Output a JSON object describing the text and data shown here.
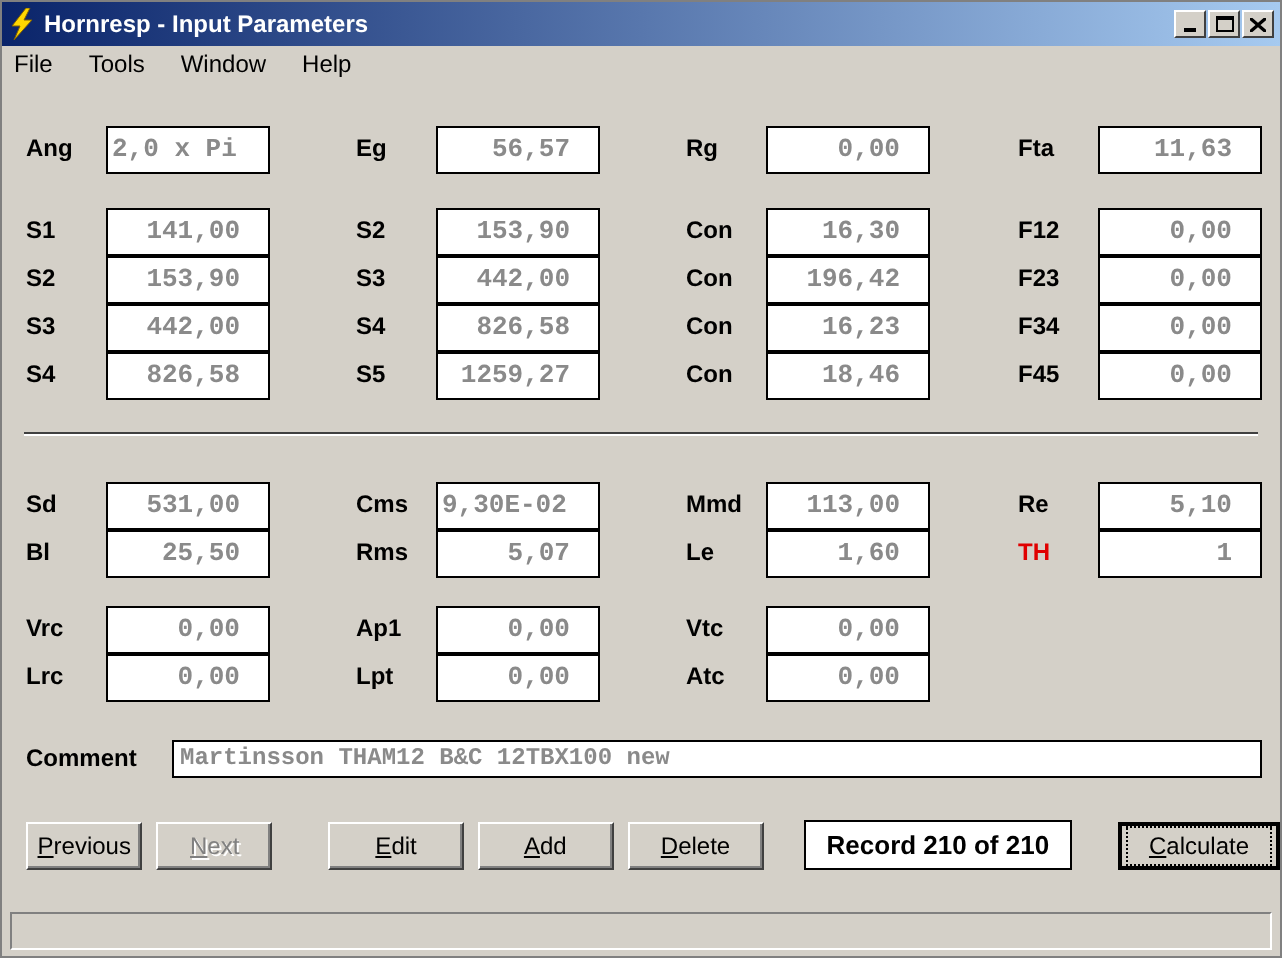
{
  "window": {
    "title": "Hornresp - Input Parameters"
  },
  "menu": [
    "File",
    "Tools",
    "Window",
    "Help"
  ],
  "blocks": [
    {
      "kind": "fields",
      "rows": [
        [
          {
            "label": "Ang",
            "value": "2,0 x Pi",
            "kind": "text"
          },
          {
            "label": "Eg",
            "value": "56,57",
            "kind": "number"
          },
          {
            "label": "Rg",
            "value": "0,00",
            "kind": "number"
          },
          {
            "label": "Fta",
            "value": "11,63",
            "kind": "number"
          }
        ]
      ]
    },
    {
      "kind": "fields",
      "rows": [
        [
          {
            "label": "S1",
            "value": "141,00",
            "kind": "number"
          },
          {
            "label": "S2",
            "value": "153,90",
            "kind": "number"
          },
          {
            "label": "Con",
            "value": "16,30",
            "kind": "number"
          },
          {
            "label": "F12",
            "value": "0,00",
            "kind": "number"
          }
        ],
        [
          {
            "label": "S2",
            "value": "153,90",
            "kind": "number"
          },
          {
            "label": "S3",
            "value": "442,00",
            "kind": "number"
          },
          {
            "label": "Con",
            "value": "196,42",
            "kind": "number"
          },
          {
            "label": "F23",
            "value": "0,00",
            "kind": "number"
          }
        ],
        [
          {
            "label": "S3",
            "value": "442,00",
            "kind": "number"
          },
          {
            "label": "S4",
            "value": "826,58",
            "kind": "number"
          },
          {
            "label": "Con",
            "value": "16,23",
            "kind": "number"
          },
          {
            "label": "F34",
            "value": "0,00",
            "kind": "number"
          }
        ],
        [
          {
            "label": "S4",
            "value": "826,58",
            "kind": "number"
          },
          {
            "label": "S5",
            "value": "1259,27",
            "kind": "number"
          },
          {
            "label": "Con",
            "value": "18,46",
            "kind": "number"
          },
          {
            "label": "F45",
            "value": "0,00",
            "kind": "number"
          }
        ]
      ]
    },
    {
      "kind": "divider"
    },
    {
      "kind": "fields",
      "rows": [
        [
          {
            "label": "Sd",
            "value": "531,00",
            "kind": "number"
          },
          {
            "label": "Cms",
            "value": "9,30E-02",
            "kind": "text"
          },
          {
            "label": "Mmd",
            "value": "113,00",
            "kind": "number"
          },
          {
            "label": "Re",
            "value": "5,10",
            "kind": "number"
          }
        ],
        [
          {
            "label": "Bl",
            "value": "25,50",
            "kind": "number"
          },
          {
            "label": "Rms",
            "value": "5,07",
            "kind": "number"
          },
          {
            "label": "Le",
            "value": "1,60",
            "kind": "number"
          },
          {
            "label": "TH",
            "value": "1",
            "kind": "number",
            "color": "#e00000"
          }
        ]
      ]
    },
    {
      "kind": "fields",
      "rows": [
        [
          {
            "label": "Vrc",
            "value": "0,00",
            "kind": "number"
          },
          {
            "label": "Ap1",
            "value": "0,00",
            "kind": "number"
          },
          {
            "label": "Vtc",
            "value": "0,00",
            "kind": "number"
          }
        ],
        [
          {
            "label": "Lrc",
            "value": "0,00",
            "kind": "number"
          },
          {
            "label": "Lpt",
            "value": "0,00",
            "kind": "number"
          },
          {
            "label": "Atc",
            "value": "0,00",
            "kind": "number"
          }
        ]
      ]
    }
  ],
  "comment": {
    "label": "Comment",
    "value": "Martinsson THAM12 B&C 12TBX100 new"
  },
  "buttons": [
    {
      "label": "Previous",
      "disabled": false,
      "focused": false
    },
    {
      "label": "Next",
      "disabled": true,
      "focused": false
    },
    {
      "label": "Edit",
      "disabled": false,
      "focused": false
    },
    {
      "label": "Add",
      "disabled": false,
      "focused": false
    },
    {
      "label": "Delete",
      "disabled": false,
      "focused": false
    }
  ],
  "record": "Record 210 of 210",
  "calculate": {
    "label": "Calculate",
    "disabled": false,
    "focused": true
  }
}
